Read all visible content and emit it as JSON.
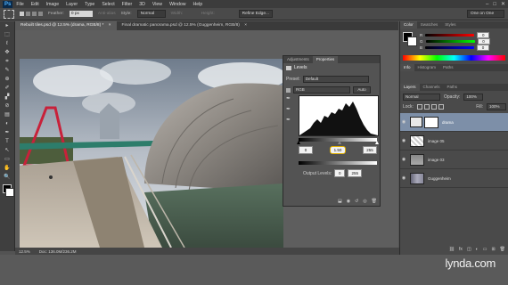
{
  "app": {
    "logo": "Ps",
    "menu": [
      "File",
      "Edit",
      "Image",
      "Layer",
      "Type",
      "Select",
      "Filter",
      "3D",
      "View",
      "Window",
      "Help"
    ],
    "window_controls": [
      "–",
      "□",
      "✕"
    ]
  },
  "options": {
    "feather_label": "Feather:",
    "feather_value": "0 px",
    "antialias_label": "Anti-alias",
    "style_label": "Style:",
    "style_value": "Normal",
    "width_label": "Width:",
    "height_label": "Height:",
    "refine_edge": "Refine Edge...",
    "workspace": "One on One"
  },
  "tabs": [
    {
      "label": "Rebuilt tiles.psd @ 12.5% (drama, RGB/8) *",
      "close": "×"
    },
    {
      "label": "Final dramatic panorama.psd @ 12.5% (Guggenheim, RGB/8)",
      "close": "×"
    }
  ],
  "tools": [
    "▸",
    "⬚",
    "ℓ",
    "✥",
    "⌗",
    "✎",
    "⊕",
    "✐",
    "▞",
    "⊘",
    "▤",
    "◐",
    "✒",
    "T",
    "↖",
    "▭",
    "✋",
    "🔍"
  ],
  "status": {
    "zoom": "12.5%",
    "doc": "Doc: 136.0M/236.2M"
  },
  "properties": {
    "tabs": [
      "Adjustments",
      "Properties"
    ],
    "title": "Levels",
    "preset_label": "Preset:",
    "preset_value": "Default",
    "channel": "RGB",
    "auto": "Auto",
    "input_black": "0",
    "input_gamma": "1.50",
    "input_white": "255",
    "output_label": "Output Levels:",
    "output_black": "0",
    "output_white": "255"
  },
  "color_panel": {
    "tabs": [
      "Color",
      "Swatches",
      "Styles"
    ],
    "channels": [
      "R",
      "G",
      "B"
    ]
  },
  "info_panel": {
    "tabs": [
      "Info",
      "Histogram",
      "Paths"
    ]
  },
  "layers": {
    "tabs": [
      "Layers",
      "Channels",
      "Paths"
    ],
    "mode": "Normal",
    "opacity_label": "Opacity:",
    "opacity_value": "100%",
    "lock_label": "Lock:",
    "fill_label": "Fill:",
    "fill_value": "100%",
    "items": [
      {
        "name": "drama",
        "selected": true,
        "type": "adjustment"
      },
      {
        "name": "image 05",
        "selected": false,
        "type": "image"
      },
      {
        "name": "image 03",
        "selected": false,
        "type": "image"
      },
      {
        "name": "Guggenheim",
        "selected": false,
        "type": "image"
      }
    ]
  },
  "watermark": "lynda.com",
  "colors": {
    "accent": "#3d6fb0",
    "selected_layer": "#7d8fa8"
  }
}
